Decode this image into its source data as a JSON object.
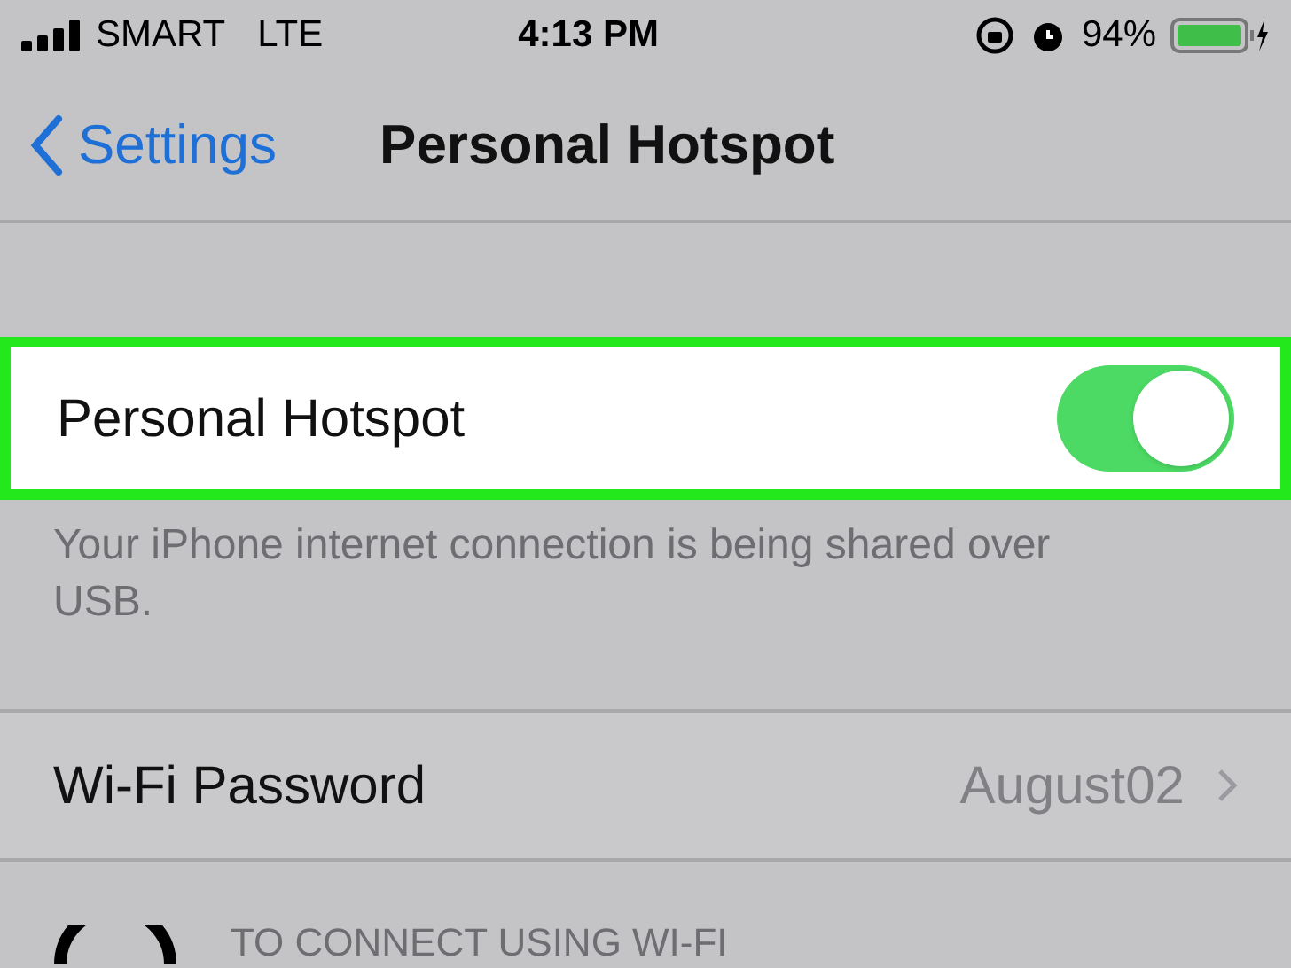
{
  "status_bar": {
    "carrier": "SMART",
    "network": "LTE",
    "time": "4:13 PM",
    "battery": "94%"
  },
  "nav": {
    "back": "Settings",
    "title": "Personal Hotspot"
  },
  "hotspot": {
    "label": "Personal Hotspot",
    "on": true,
    "highlighted": true
  },
  "footer": "Your iPhone internet connection is being shared over USB.",
  "wifi_password": {
    "label": "Wi-Fi Password",
    "value": "August02"
  },
  "instructions": {
    "heading": "TO CONNECT USING WI-FI"
  }
}
